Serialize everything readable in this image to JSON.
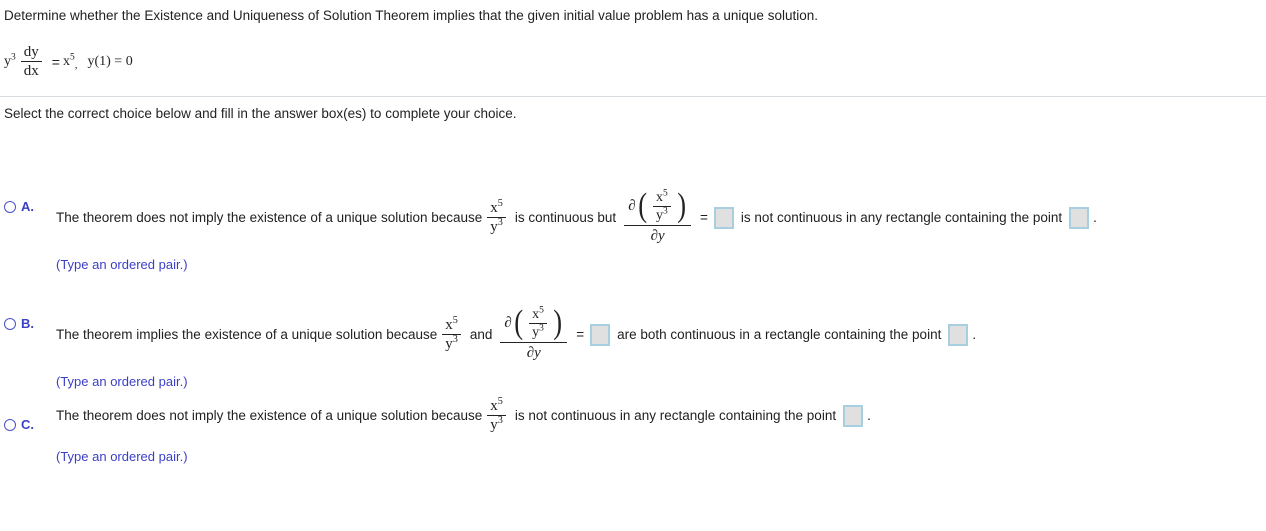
{
  "question": {
    "stem": "Determine whether the Existence and Uniqueness of Solution Theorem implies that the given initial value problem has a unique solution.",
    "equation": {
      "lhs_base": "y",
      "lhs_exp": "3",
      "derivative_num": "dy",
      "derivative_den": "dx",
      "equals": "=",
      "rhs_base": "x",
      "rhs_exp": "5",
      "comma": ",",
      "initial_condition": "y(1) = 0"
    },
    "instruction": "Select the correct choice below and fill in the answer box(es) to complete your choice."
  },
  "math_symbols": {
    "numerator_base": "x",
    "numerator_exp": "5",
    "denominator_base": "y",
    "denominator_exp": "3",
    "partial_symbol": "∂",
    "partial_den": "∂y",
    "paren_open": "(",
    "paren_close": ")",
    "equals": "="
  },
  "choices": [
    {
      "id": "A",
      "letter": "A.",
      "selected": false,
      "text_before_fraction": "The theorem does not imply the existence of a unique solution because",
      "text_after_fraction": "is continuous but",
      "text_after_partial": "is not continuous in any rectangle containing the point",
      "trailing_period": ".",
      "note": "(Type an ordered pair.)",
      "answer_boxes": 2
    },
    {
      "id": "B",
      "letter": "B.",
      "selected": false,
      "text_before_fraction": "The theorem implies the existence of a unique solution because",
      "text_between": "and",
      "text_after_partial": "are both continuous in a rectangle containing the point",
      "trailing_period": ".",
      "note": "(Type an ordered pair.)",
      "answer_boxes": 2
    },
    {
      "id": "C",
      "letter": "C.",
      "selected": false,
      "text_before_fraction": "The theorem does not imply the existence of a unique solution because",
      "text_after_fraction": "is not continuous in any rectangle containing the point",
      "trailing_period": ".",
      "note": "(Type an ordered pair.)",
      "answer_boxes": 1
    }
  ],
  "colors": {
    "accent_blue": "#3b3fc4",
    "answer_box_border": "#a8cfe0",
    "answer_box_fill": "#e0e0e0",
    "divider": "#d8dde2",
    "text": "#1f1f1f"
  }
}
